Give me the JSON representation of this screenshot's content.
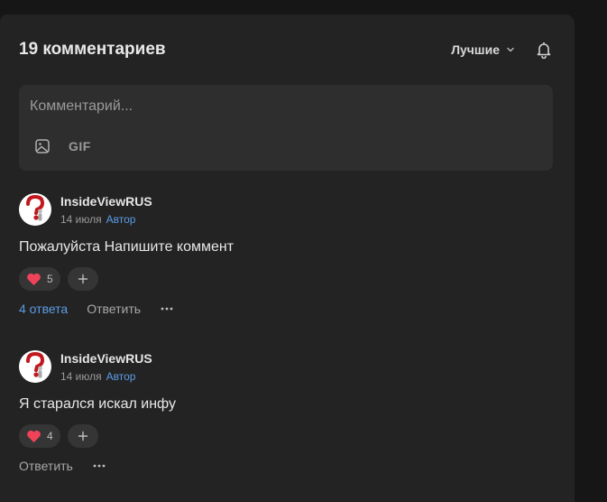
{
  "header": {
    "title": "19 комментариев",
    "sort_label": "Лучшие"
  },
  "composer": {
    "placeholder": "Комментарий...",
    "gif_label": "GIF"
  },
  "comments": [
    {
      "author": "InsideViewRUS",
      "date": "14 июля",
      "badge": "Автор",
      "text": "Пожалуйста Напишите коммент",
      "reaction_count": "5",
      "replies_label": "4 ответа",
      "reply_label": "Ответить"
    },
    {
      "author": "InsideViewRUS",
      "date": "14 июля",
      "badge": "Автор",
      "text": "Я старался искал инфу",
      "reaction_count": "4",
      "reply_label": "Ответить"
    }
  ],
  "icons": {
    "sort": "chevron-down-icon",
    "notifications": "bell-icon",
    "attach_image": "image-icon",
    "reaction": "heart-icon",
    "add_reaction": "plus-icon",
    "more": "more-horizontal-icon"
  },
  "colors": {
    "background": "#161616",
    "panel": "#232323",
    "input": "#2e2e2e",
    "accent": "#5b9ce6",
    "heart": "#f0435a"
  }
}
